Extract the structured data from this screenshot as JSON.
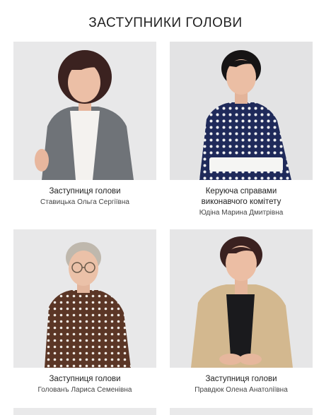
{
  "page": {
    "title": "ЗАСТУПНИКИ ГОЛОВИ"
  },
  "cards": [
    {
      "role": "Заступниця голови",
      "role2": "",
      "name": "Ставицька Ольга Сергіївна"
    },
    {
      "role": "Керуюча справами",
      "role2": "виконавчого комітету",
      "name": "Юдіна Марина Дмитрівна"
    },
    {
      "role": "Заступниця голови",
      "role2": "",
      "name": "Голованъ Лариса Семенівна"
    },
    {
      "role": "Заступниця голови",
      "role2": "",
      "name": "Правдюк Олена Анатоліївна"
    }
  ]
}
